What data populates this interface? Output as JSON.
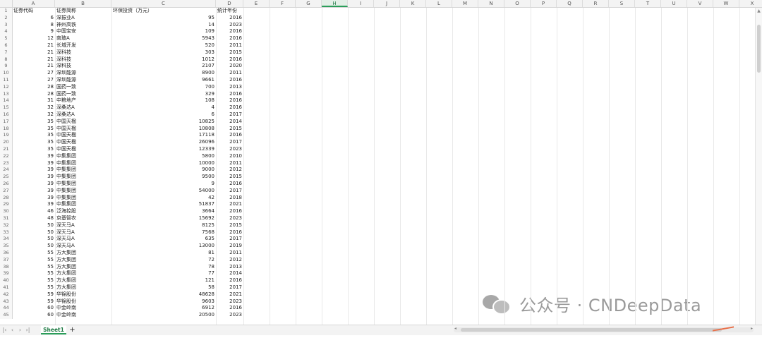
{
  "columns": [
    "A",
    "B",
    "C",
    "D",
    "E",
    "F",
    "G",
    "H",
    "I",
    "J",
    "K",
    "L",
    "M",
    "N",
    "O",
    "P",
    "Q",
    "R",
    "S",
    "T",
    "U",
    "V",
    "W",
    "X"
  ],
  "active_column": "H",
  "header_row": {
    "code": "证券代码",
    "name": "证券简称",
    "invest": "环保投资（万元）",
    "year": "统计年份"
  },
  "rows": [
    {
      "n": 2,
      "code": "6",
      "name": "深振业A",
      "invest": "95",
      "year": "2016"
    },
    {
      "n": 3,
      "code": "8",
      "name": "神州高铁",
      "invest": "14",
      "year": "2023"
    },
    {
      "n": 4,
      "code": "9",
      "name": "中国宝安",
      "invest": "109",
      "year": "2016"
    },
    {
      "n": 5,
      "code": "12",
      "name": "南玻A",
      "invest": "5943",
      "year": "2016"
    },
    {
      "n": 6,
      "code": "21",
      "name": "长城开发",
      "invest": "520",
      "year": "2011"
    },
    {
      "n": 7,
      "code": "21",
      "name": "深科技",
      "invest": "303",
      "year": "2015"
    },
    {
      "n": 8,
      "code": "21",
      "name": "深科技",
      "invest": "1012",
      "year": "2016"
    },
    {
      "n": 9,
      "code": "21",
      "name": "深科技",
      "invest": "2107",
      "year": "2020"
    },
    {
      "n": 10,
      "code": "27",
      "name": "深圳能源",
      "invest": "8900",
      "year": "2011"
    },
    {
      "n": 11,
      "code": "27",
      "name": "深圳能源",
      "invest": "9661",
      "year": "2016"
    },
    {
      "n": 12,
      "code": "28",
      "name": "国药一致",
      "invest": "700",
      "year": "2013"
    },
    {
      "n": 13,
      "code": "28",
      "name": "国药一致",
      "invest": "329",
      "year": "2016"
    },
    {
      "n": 14,
      "code": "31",
      "name": "中粮地产",
      "invest": "108",
      "year": "2016"
    },
    {
      "n": 15,
      "code": "32",
      "name": "深桑达A",
      "invest": "4",
      "year": "2016"
    },
    {
      "n": 16,
      "code": "32",
      "name": "深桑达A",
      "invest": "6",
      "year": "2017"
    },
    {
      "n": 17,
      "code": "35",
      "name": "中国天楹",
      "invest": "10825",
      "year": "2014"
    },
    {
      "n": 18,
      "code": "35",
      "name": "中国天楹",
      "invest": "10808",
      "year": "2015"
    },
    {
      "n": 19,
      "code": "35",
      "name": "中国天楹",
      "invest": "17118",
      "year": "2016"
    },
    {
      "n": 20,
      "code": "35",
      "name": "中国天楹",
      "invest": "26096",
      "year": "2017"
    },
    {
      "n": 21,
      "code": "35",
      "name": "中国天楹",
      "invest": "12339",
      "year": "2023"
    },
    {
      "n": 22,
      "code": "39",
      "name": "中集集团",
      "invest": "5800",
      "year": "2010"
    },
    {
      "n": 23,
      "code": "39",
      "name": "中集集团",
      "invest": "10000",
      "year": "2011"
    },
    {
      "n": 24,
      "code": "39",
      "name": "中集集团",
      "invest": "9000",
      "year": "2012"
    },
    {
      "n": 25,
      "code": "39",
      "name": "中集集团",
      "invest": "9500",
      "year": "2015"
    },
    {
      "n": 26,
      "code": "39",
      "name": "中集集团",
      "invest": "9",
      "year": "2016"
    },
    {
      "n": 27,
      "code": "39",
      "name": "中集集团",
      "invest": "54000",
      "year": "2017"
    },
    {
      "n": 28,
      "code": "39",
      "name": "中集集团",
      "invest": "42",
      "year": "2018"
    },
    {
      "n": 29,
      "code": "39",
      "name": "中集集团",
      "invest": "51837",
      "year": "2021"
    },
    {
      "n": 30,
      "code": "46",
      "name": "泛海控股",
      "invest": "3664",
      "year": "2016"
    },
    {
      "n": 31,
      "code": "48",
      "name": "京基智农",
      "invest": "15692",
      "year": "2023"
    },
    {
      "n": 32,
      "code": "50",
      "name": "深天马A",
      "invest": "8125",
      "year": "2015"
    },
    {
      "n": 33,
      "code": "50",
      "name": "深天马A",
      "invest": "7568",
      "year": "2016"
    },
    {
      "n": 34,
      "code": "50",
      "name": "深天马A",
      "invest": "635",
      "year": "2017"
    },
    {
      "n": 35,
      "code": "50",
      "name": "深天马A",
      "invest": "13000",
      "year": "2019"
    },
    {
      "n": 36,
      "code": "55",
      "name": "方大集团",
      "invest": "81",
      "year": "2011"
    },
    {
      "n": 37,
      "code": "55",
      "name": "方大集团",
      "invest": "72",
      "year": "2012"
    },
    {
      "n": 38,
      "code": "55",
      "name": "方大集团",
      "invest": "78",
      "year": "2013"
    },
    {
      "n": 39,
      "code": "55",
      "name": "方大集团",
      "invest": "77",
      "year": "2014"
    },
    {
      "n": 40,
      "code": "55",
      "name": "方大集团",
      "invest": "121",
      "year": "2016"
    },
    {
      "n": 41,
      "code": "55",
      "name": "方大集团",
      "invest": "58",
      "year": "2017"
    },
    {
      "n": 42,
      "code": "59",
      "name": "华锦股份",
      "invest": "48628",
      "year": "2021"
    },
    {
      "n": 43,
      "code": "59",
      "name": "华锦股份",
      "invest": "9603",
      "year": "2023"
    },
    {
      "n": 44,
      "code": "60",
      "name": "中金岭南",
      "invest": "6912",
      "year": "2016"
    },
    {
      "n": 45,
      "code": "60",
      "name": "中金岭南",
      "invest": "20500",
      "year": "2023"
    }
  ],
  "sheet_tab": "Sheet1",
  "add_sheet": "+",
  "watermark": "公众号 · CNDeepData",
  "icons": {
    "nav_first": "first-sheet-icon",
    "nav_prev": "prev-sheet-icon",
    "nav_next": "next-sheet-icon",
    "nav_last": "last-sheet-icon"
  }
}
